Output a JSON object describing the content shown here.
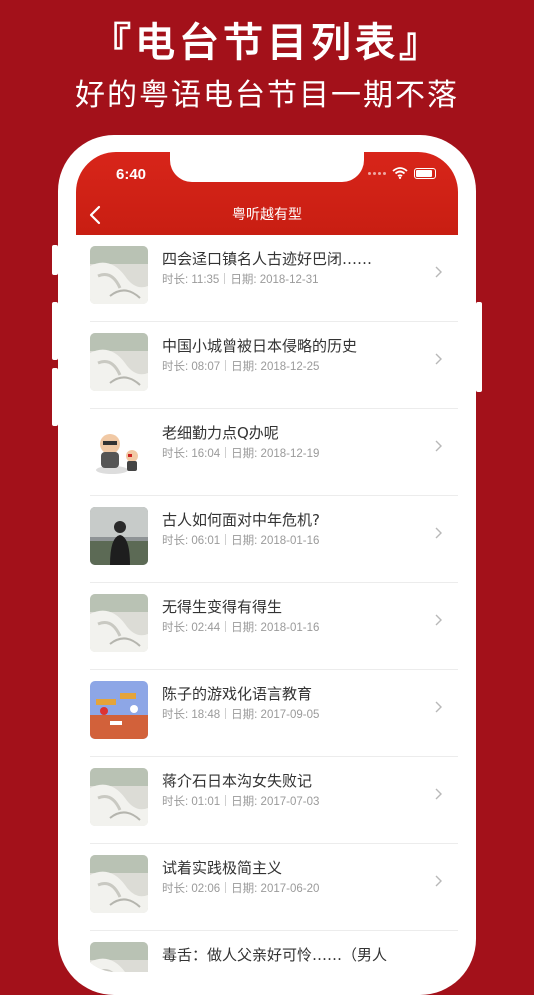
{
  "promo": {
    "title": "『电台节目列表』",
    "subtitle": "好的粤语电台节目一期不落"
  },
  "status_bar": {
    "time": "6:40"
  },
  "nav": {
    "title": "粤听越有型",
    "back_icon": "chevron-left-icon"
  },
  "colors": {
    "background": "#a3111a",
    "nav_red": "#d3221a"
  },
  "episodes": [
    {
      "title": "四会迳口镇名人古迹好巴闭……",
      "duration_label": "时长: 11:35",
      "date_label": "日期: 2018-12-31",
      "thumb": "cloth"
    },
    {
      "title": "中国小城曾被日本侵略的历史",
      "duration_label": "时长: 08:07",
      "date_label": "日期: 2018-12-25",
      "thumb": "cloth"
    },
    {
      "title": "老细勤力点Q办呢",
      "duration_label": "时长: 16:04",
      "date_label": "日期: 2018-12-19",
      "thumb": "cartoon"
    },
    {
      "title": "古人如何面对中年危机?",
      "duration_label": "时长: 06:01",
      "date_label": "日期: 2018-01-16",
      "thumb": "person"
    },
    {
      "title": "无得生变得有得生",
      "duration_label": "时长: 02:44",
      "date_label": "日期: 2018-01-16",
      "thumb": "cloth"
    },
    {
      "title": "陈子的游戏化语言教育",
      "duration_label": "时长: 18:48",
      "date_label": "日期: 2017-09-05",
      "thumb": "game"
    },
    {
      "title": "蒋介石日本沟女失败记",
      "duration_label": "时长: 01:01",
      "date_label": "日期: 2017-07-03",
      "thumb": "cloth"
    },
    {
      "title": "试着实践极简主义",
      "duration_label": "时长: 02:06",
      "date_label": "日期: 2017-06-20",
      "thumb": "cloth"
    },
    {
      "title": "毒舌：做人父亲好可怜……（男人",
      "duration_label": "",
      "date_label": "",
      "thumb": "cloth"
    }
  ]
}
